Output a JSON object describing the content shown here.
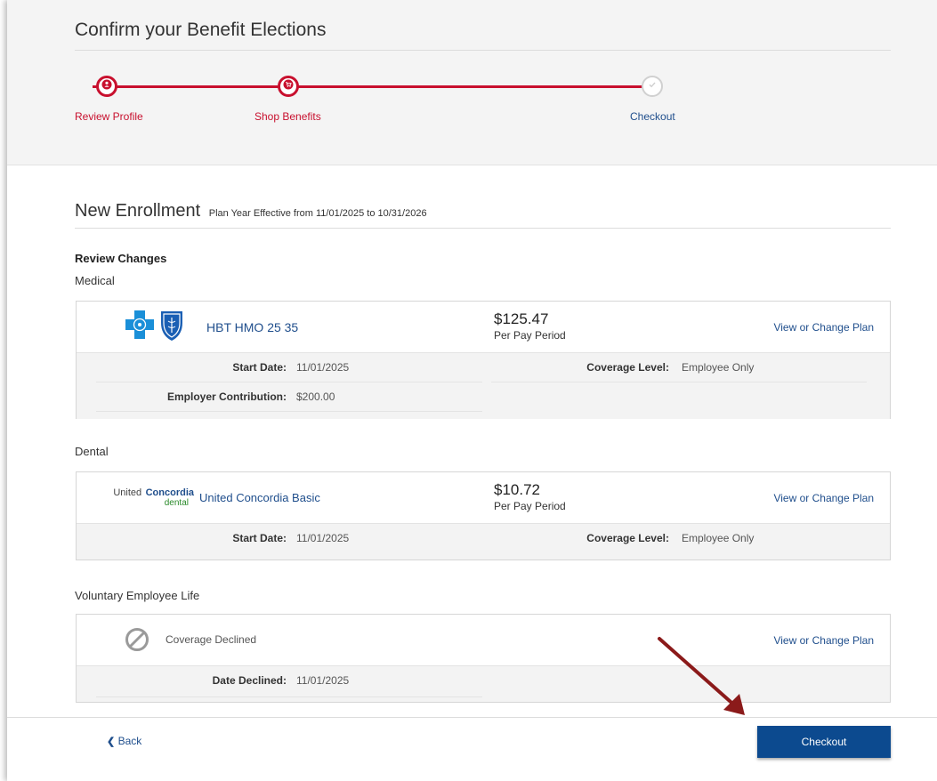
{
  "page": {
    "title": "Confirm your Benefit Elections"
  },
  "steps": [
    {
      "label": "Review Profile",
      "state": "complete",
      "icon": "user-icon"
    },
    {
      "label": "Shop Benefits",
      "state": "complete",
      "icon": "cart-icon"
    },
    {
      "label": "Checkout",
      "state": "current",
      "icon": "check-icon"
    }
  ],
  "enrollment": {
    "title": "New Enrollment",
    "subtitle": "Plan Year Effective from 11/01/2025 to 10/31/2026",
    "review_heading": "Review Changes"
  },
  "sections": {
    "medical": {
      "label": "Medical",
      "plan_name": "HBT HMO 25 35",
      "price": "$125.47",
      "price_period": "Per Pay Period",
      "change_link": "View or Change Plan",
      "start_date_label": "Start Date:",
      "start_date": "11/01/2025",
      "coverage_level_label": "Coverage Level:",
      "coverage_level": "Employee Only",
      "employer_contribution_label": "Employer Contribution:",
      "employer_contribution": "$200.00"
    },
    "dental": {
      "label": "Dental",
      "logo_text_united": "United",
      "logo_text_concordia": "Concordia",
      "logo_text_dental": "dental",
      "plan_name": "United Concordia Basic",
      "price": "$10.72",
      "price_period": "Per Pay Period",
      "change_link": "View or Change Plan",
      "start_date_label": "Start Date:",
      "start_date": "11/01/2025",
      "coverage_level_label": "Coverage Level:",
      "coverage_level": "Employee Only"
    },
    "life": {
      "label": "Voluntary Employee Life",
      "status": "Coverage Declined",
      "change_link": "View or Change Plan",
      "date_declined_label": "Date Declined:",
      "date_declined": "11/01/2025"
    }
  },
  "footer": {
    "back_label": "Back",
    "checkout_label": "Checkout"
  },
  "colors": {
    "brand_red": "#c8102e",
    "link_blue": "#1f4e8c",
    "button_blue": "#0c4a8f",
    "annotation_arrow": "#8b1a1a"
  }
}
